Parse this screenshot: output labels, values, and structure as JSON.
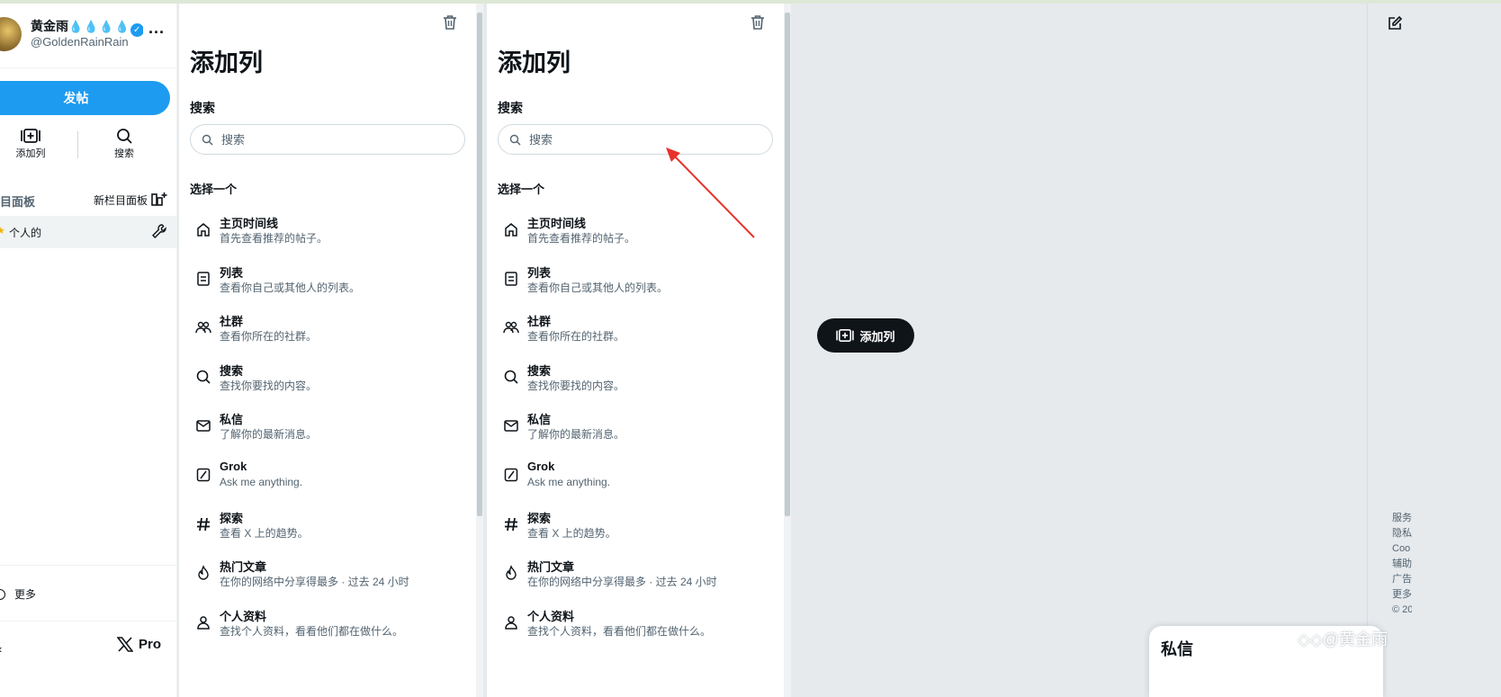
{
  "profile": {
    "name": "黄金雨",
    "handle": "@GoldenRainRain"
  },
  "sidebar": {
    "post_label": "发帖",
    "quick_add_label": "添加列",
    "quick_search_label": "搜索",
    "decks_title": "目面板",
    "new_deck_label": "新栏目面板",
    "deck_item": "个人的",
    "more_label": "更多",
    "pro_label": "Pro",
    "x_glyph": "X"
  },
  "add_column": {
    "title": "添加列",
    "search_label": "搜索",
    "search_placeholder": "搜索",
    "pick_label": "选择一个",
    "options": [
      {
        "title": "主页时间线",
        "desc": "首先查看推荐的帖子。",
        "icon": "home-icon"
      },
      {
        "title": "列表",
        "desc": "查看你自己或其他人的列表。",
        "icon": "list-icon"
      },
      {
        "title": "社群",
        "desc": "查看你所在的社群。",
        "icon": "communities-icon"
      },
      {
        "title": "搜索",
        "desc": "查找你要找的内容。",
        "icon": "search-icon"
      },
      {
        "title": "私信",
        "desc": "了解你的最新消息。",
        "icon": "mail-icon"
      },
      {
        "title": "Grok",
        "desc": "Ask me anything.",
        "icon": "grok-icon"
      },
      {
        "title": "探索",
        "desc": "查看 X 上的趋势。",
        "icon": "hashtag-icon"
      },
      {
        "title": "热门文章",
        "desc": "在你的网络中分享得最多 · 过去 24 小时",
        "icon": "flame-icon"
      },
      {
        "title": "个人资料",
        "desc": "查找个人资料，看看他们都在做什么。",
        "icon": "person-icon"
      }
    ]
  },
  "center": {
    "add_column_button": "添加列"
  },
  "rightbar": {
    "footer_links": [
      "服务",
      "隐私",
      "Coo",
      "辅助",
      "广告",
      "更多",
      "© 20"
    ]
  },
  "dm": {
    "title": "私信"
  },
  "watermark": "@黄金雨",
  "colors": {
    "accent": "#1d9bf0",
    "dark": "#0f1419",
    "annotation": "#e8312b"
  }
}
